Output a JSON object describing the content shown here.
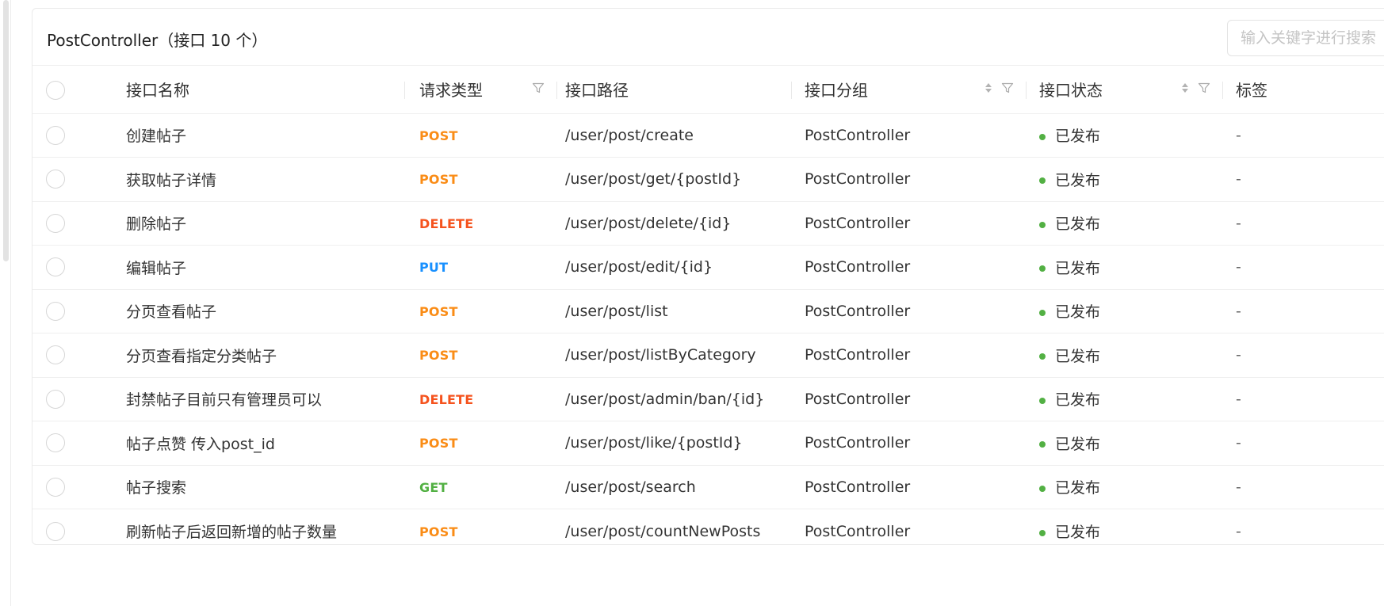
{
  "header": {
    "title_prefix": "PostController（接口 10 个）",
    "search_placeholder": "输入关键字进行搜索"
  },
  "columns": {
    "name": "接口名称",
    "method": "请求类型",
    "path": "接口路径",
    "group": "接口分组",
    "status": "接口状态",
    "tags": "标签"
  },
  "colors": {
    "POST": "#fa8c16",
    "DELETE": "#f5531e",
    "PUT": "#1890ff",
    "GET": "#52b043",
    "status_published": "#52b043"
  },
  "rows": [
    {
      "name": "创建帖子",
      "method": "POST",
      "path": "/user/post/create",
      "group": "PostController",
      "status": "已发布",
      "tags": "-"
    },
    {
      "name": "获取帖子详情",
      "method": "POST",
      "path": "/user/post/get/{postId}",
      "group": "PostController",
      "status": "已发布",
      "tags": "-"
    },
    {
      "name": "删除帖子",
      "method": "DELETE",
      "path": "/user/post/delete/{id}",
      "group": "PostController",
      "status": "已发布",
      "tags": "-"
    },
    {
      "name": "编辑帖子",
      "method": "PUT",
      "path": "/user/post/edit/{id}",
      "group": "PostController",
      "status": "已发布",
      "tags": "-"
    },
    {
      "name": "分页查看帖子",
      "method": "POST",
      "path": "/user/post/list",
      "group": "PostController",
      "status": "已发布",
      "tags": "-"
    },
    {
      "name": "分页查看指定分类帖子",
      "method": "POST",
      "path": "/user/post/listByCategory",
      "group": "PostController",
      "status": "已发布",
      "tags": "-"
    },
    {
      "name": "封禁帖子目前只有管理员可以",
      "method": "DELETE",
      "path": "/user/post/admin/ban/{id}",
      "group": "PostController",
      "status": "已发布",
      "tags": "-"
    },
    {
      "name": "帖子点赞 传入post_id",
      "method": "POST",
      "path": "/user/post/like/{postId}",
      "group": "PostController",
      "status": "已发布",
      "tags": "-"
    },
    {
      "name": "帖子搜索",
      "method": "GET",
      "path": "/user/post/search",
      "group": "PostController",
      "status": "已发布",
      "tags": "-"
    },
    {
      "name": "刷新帖子后返回新增的帖子数量",
      "method": "POST",
      "path": "/user/post/countNewPosts",
      "group": "PostController",
      "status": "已发布",
      "tags": "-"
    }
  ]
}
